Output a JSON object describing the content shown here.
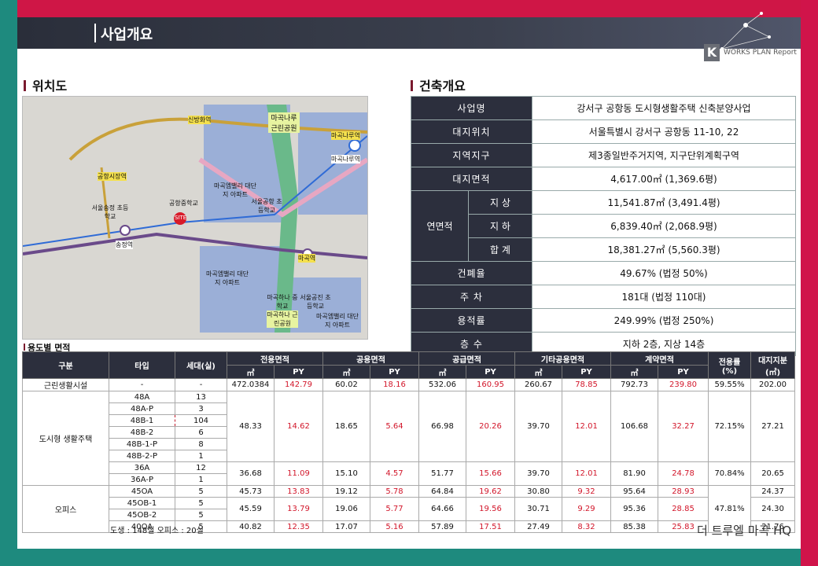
{
  "header": {
    "title": "사업개요",
    "logo_letter": "K",
    "logo_text": "WORKS PLAN Report"
  },
  "location": {
    "title": "위치도",
    "labels": {
      "sinbang": "신방화역",
      "gonghang_market": "공항시장역",
      "magoknaru": "마곡나루역",
      "magoknaru2": "마곡나루역",
      "park1": "마곡나루 근린공원",
      "apt1": "마곡엠밸리 대단지 아파트",
      "gonghang_mid": "공항중학교",
      "seoulsongjeong": "서울송정 초등학교",
      "site": "SITE",
      "songjeong": "송정역",
      "seoulgonghang": "서울공항 초등학교",
      "magok": "마곡역",
      "apt2": "마곡엠밸리 대단지 아파트",
      "magok_high": "마곡하나 중학교",
      "seoulgonggin": "서울공진 초등학교",
      "park2": "마곡하나 근린공원",
      "apt3": "마곡엠밸리 대단지 아파트"
    }
  },
  "building": {
    "title": "건축개요",
    "rows": {
      "project_label": "사업명",
      "project_value": "강서구 공항동 도시형생활주택 신축분양사업",
      "site_label": "대지위치",
      "site_value": "서울특별시 강서구 공항동 11-10, 22",
      "zone_label": "지역지구",
      "zone_value": "제3종일반주거지역, 지구단위계획구역",
      "land_label": "대지면적",
      "land_value": "4,617.00㎡ (1,369.6평)",
      "floor_label": "연면적",
      "above_label": "지 상",
      "above_value": "11,541.87㎡ (3,491.4평)",
      "below_label": "지 하",
      "below_value": "6,839.40㎡ (2,068.9평)",
      "total_label": "합 계",
      "total_value": "18,381.27㎡ (5,560.3평)",
      "bcr_label": "건폐율",
      "bcr_value": "49.67% (법정 50%)",
      "parking_label": "주 차",
      "parking_value": "181대 (법정 110대)",
      "far_label": "용적률",
      "far_value": "249.99% (법정 250%)",
      "floors_label": "층 수",
      "floors_value": "지하 2층, 지상 14층"
    }
  },
  "usage": {
    "title": "용도별 면적",
    "headers": {
      "gubun": "구분",
      "type": "타입",
      "units": "세대(실)",
      "exclusive": "전용면적",
      "common": "공용면적",
      "supply": "공급면적",
      "other": "기타공용면적",
      "contract": "계약면적",
      "ratio": "전용률",
      "ratio_unit": "(%)",
      "land": "대지지분",
      "land_unit": "(㎡)",
      "m2": "㎡",
      "py": "PY"
    },
    "groups": {
      "retail": "근린생활시설",
      "housing": "도시형 생활주택",
      "office": "오피스"
    },
    "retail": {
      "type": "-",
      "units": "-",
      "ex_m2": "472.0384",
      "ex_py": "142.79",
      "cm_m2": "60.02",
      "cm_py": "18.16",
      "sp_m2": "532.06",
      "sp_py": "160.95",
      "ot_m2": "260.67",
      "ot_py": "78.85",
      "ct_m2": "792.73",
      "ct_py": "239.80",
      "ratio": "59.55%",
      "land": "202.00"
    },
    "housing_types": [
      {
        "type": "48A",
        "units": "13"
      },
      {
        "type": "48A-P",
        "units": "3"
      },
      {
        "type": "48B-1",
        "units": "104"
      },
      {
        "type": "48B-2",
        "units": "6"
      },
      {
        "type": "48B-1-P",
        "units": "8"
      },
      {
        "type": "48B-2-P",
        "units": "1"
      },
      {
        "type": "36A",
        "units": "12"
      },
      {
        "type": "36A-P",
        "units": "1"
      }
    ],
    "housing48": {
      "ex_m2": "48.33",
      "ex_py": "14.62",
      "cm_m2": "18.65",
      "cm_py": "5.64",
      "sp_m2": "66.98",
      "sp_py": "20.26",
      "ot_m2": "39.70",
      "ot_py": "12.01",
      "ct_m2": "106.68",
      "ct_py": "32.27",
      "ratio": "72.15%",
      "land": "27.21"
    },
    "housing36": {
      "ex_m2": "36.68",
      "ex_py": "11.09",
      "cm_m2": "15.10",
      "cm_py": "4.57",
      "sp_m2": "51.77",
      "sp_py": "15.66",
      "ot_m2": "39.70",
      "ot_py": "12.01",
      "ct_m2": "81.90",
      "ct_py": "24.78",
      "ratio": "70.84%",
      "land": "20.65"
    },
    "office_rows": [
      {
        "type": "45OA",
        "units": "5",
        "ex_m2": "45.73",
        "ex_py": "13.83",
        "cm_m2": "19.12",
        "cm_py": "5.78",
        "sp_m2": "64.84",
        "sp_py": "19.62",
        "ot_m2": "30.80",
        "ot_py": "9.32",
        "ct_m2": "95.64",
        "ct_py": "28.93",
        "land": "24.37"
      },
      {
        "type": "45OB-1",
        "units": "5"
      },
      {
        "type": "45OB-2",
        "units": "5"
      },
      {
        "type": "40OA",
        "units": "5",
        "ex_m2": "40.82",
        "ex_py": "12.35",
        "cm_m2": "17.07",
        "cm_py": "5.16",
        "sp_m2": "57.89",
        "sp_py": "17.51",
        "ot_m2": "27.49",
        "ot_py": "8.32",
        "ct_m2": "85.38",
        "ct_py": "25.83",
        "land": "21.76"
      }
    ],
    "office45b": {
      "ex_m2": "45.59",
      "ex_py": "13.79",
      "cm_m2": "19.06",
      "cm_py": "5.77",
      "sp_m2": "64.66",
      "sp_py": "19.56",
      "ot_m2": "30.71",
      "ot_py": "9.29",
      "ct_m2": "95.36",
      "ct_py": "28.85",
      "land": "24.30"
    },
    "office_ratio": "47.81%"
  },
  "footer": {
    "note": "도생 : 148실 오피스 : 20실",
    "brand": "더 트루엘 마곡 HQ"
  }
}
